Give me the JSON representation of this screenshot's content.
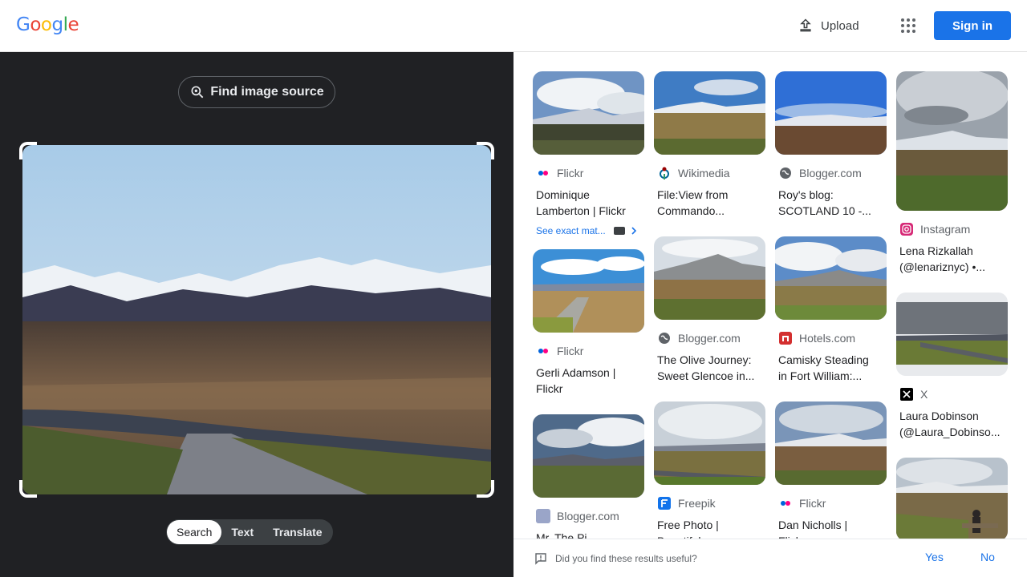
{
  "header": {
    "logo": "Google",
    "upload_label": "Upload",
    "signin_label": "Sign in"
  },
  "left": {
    "find_source_label": "Find image source",
    "modes": [
      "Search",
      "Text",
      "Translate"
    ],
    "active_mode": "Search"
  },
  "results": {
    "col1": [
      {
        "source": "Flickr",
        "title_lines": [
          "Dominique",
          "Lamberton | Flickr"
        ],
        "exact": "See exact mat..."
      },
      {
        "source": "Flickr",
        "title_lines": [
          "Gerli Adamson |",
          "Flickr"
        ]
      },
      {
        "source": "Blogger.com",
        "title_lines": [
          "Mr. The Pi..."
        ]
      }
    ],
    "col2": [
      {
        "source": "Wikimedia",
        "title_lines": [
          "File:View from",
          "Commando..."
        ]
      },
      {
        "source": "Blogger.com",
        "title_lines": [
          "The Olive Journey:",
          "Sweet Glencoe in..."
        ]
      },
      {
        "source": "Freepik",
        "title_lines": [
          "Free Photo |",
          "Beautiful..."
        ]
      }
    ],
    "col3": [
      {
        "source": "Blogger.com",
        "title_lines": [
          "Roy's blog:",
          "SCOTLAND 10 -..."
        ]
      },
      {
        "source": "Hotels.com",
        "title_lines": [
          "Camisky Steading",
          "in Fort William:..."
        ]
      },
      {
        "source": "Flickr",
        "title_lines": [
          "Dan Nicholls |",
          "Flickr"
        ]
      }
    ],
    "col4": [
      {
        "source": "Instagram",
        "title_lines": [
          "Lena Rizkallah",
          "(@lenariznyc) •..."
        ]
      },
      {
        "source": "X",
        "title_lines": [
          "Laura Dobinson",
          "(@Laura_Dobinso..."
        ]
      }
    ]
  },
  "feedback": {
    "question": "Did you find these results useful?",
    "yes": "Yes",
    "no": "No"
  },
  "colors": {
    "accent": "#1a73e8",
    "dark_bg": "#202124"
  }
}
